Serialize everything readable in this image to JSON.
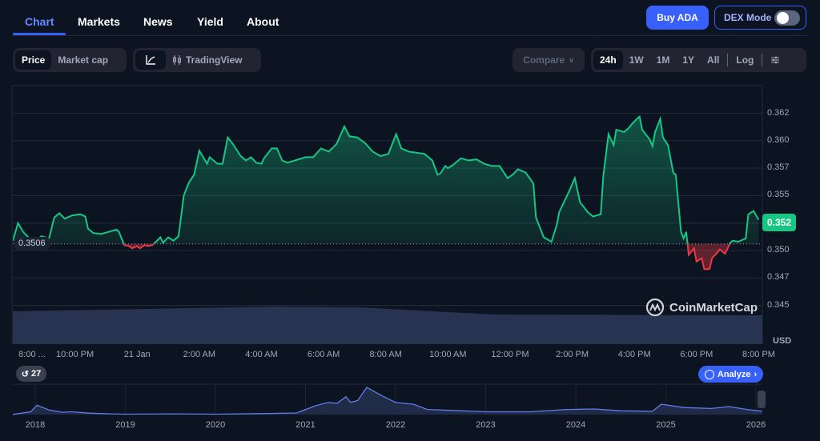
{
  "nav": {
    "tabs": [
      {
        "label": "Chart",
        "active": true
      },
      {
        "label": "Markets"
      },
      {
        "label": "News"
      },
      {
        "label": "Yield"
      },
      {
        "label": "About"
      }
    ],
    "buy_label": "Buy ADA",
    "dex_label": "DEX Mode",
    "dex_enabled": false
  },
  "toolbar": {
    "metric": [
      "Price",
      "Market cap"
    ],
    "metric_selected": "Price",
    "chart_type_line_icon": "line-chart-icon",
    "tradingview_label": "TradingView",
    "compare_label": "Compare",
    "ranges": [
      "24h",
      "1W",
      "1M",
      "1Y",
      "All"
    ],
    "range_selected": "24h",
    "log_label": "Log",
    "settings_icon": "sliders-icon"
  },
  "chart_data": {
    "type": "area",
    "currency": "USD",
    "current_price_label": "0.352",
    "baseline_label": "0.3506",
    "baseline": 0.3506,
    "ylim": [
      0.3415,
      0.365
    ],
    "y_ticks": [
      {
        "value": 0.3625,
        "label": "0.362"
      },
      {
        "value": 0.36,
        "label": "0.360"
      },
      {
        "value": 0.3575,
        "label": "0.357"
      },
      {
        "value": 0.355,
        "label": "0.355"
      },
      {
        "value": 0.3525,
        "label": "0.352"
      },
      {
        "value": 0.35,
        "label": "0.350"
      },
      {
        "value": 0.3475,
        "label": "0.347"
      },
      {
        "value": 0.345,
        "label": "0.345"
      }
    ],
    "x_ticks": [
      {
        "time": "20:00",
        "label": "8:00 ..."
      },
      {
        "time": "22:00",
        "label": "10:00 PM"
      },
      {
        "time": "00:00",
        "label": "21 Jan"
      },
      {
        "time": "02:00",
        "label": "2:00 AM"
      },
      {
        "time": "04:00",
        "label": "4:00 AM"
      },
      {
        "time": "06:00",
        "label": "6:00 AM"
      },
      {
        "time": "08:00",
        "label": "8:00 AM"
      },
      {
        "time": "10:00",
        "label": "10:00 AM"
      },
      {
        "time": "12:00",
        "label": "12:00 PM"
      },
      {
        "time": "14:00",
        "label": "2:00 PM"
      },
      {
        "time": "16:00",
        "label": "4:00 PM"
      },
      {
        "time": "18:00",
        "label": "6:00 PM"
      },
      {
        "time": "20:00",
        "label": "8:00 PM"
      }
    ],
    "points": [
      [
        "20:00",
        0.3509
      ],
      [
        "20:10",
        0.3525
      ],
      [
        "20:20",
        0.3517
      ],
      [
        "20:30",
        0.3512
      ],
      [
        "20:45",
        0.3509
      ],
      [
        "20:55",
        0.3513
      ],
      [
        "21:10",
        0.3511
      ],
      [
        "21:20",
        0.353
      ],
      [
        "21:30",
        0.3534
      ],
      [
        "21:40",
        0.3529
      ],
      [
        "21:55",
        0.3532
      ],
      [
        "22:10",
        0.3533
      ],
      [
        "22:20",
        0.3531
      ],
      [
        "22:25",
        0.352
      ],
      [
        "22:35",
        0.3516
      ],
      [
        "22:50",
        0.3515
      ],
      [
        "23:05",
        0.3517
      ],
      [
        "23:20",
        0.3519
      ],
      [
        "23:25",
        0.3517
      ],
      [
        "23:35",
        0.3505
      ],
      [
        "23:45",
        0.3504
      ],
      [
        "23:50",
        0.3502
      ],
      [
        "00:00",
        0.3504
      ],
      [
        "00:05",
        0.3502
      ],
      [
        "00:15",
        0.3505
      ],
      [
        "00:20",
        0.3504
      ],
      [
        "00:30",
        0.3505
      ],
      [
        "00:45",
        0.3512
      ],
      [
        "00:50",
        0.3507
      ],
      [
        "01:00",
        0.3512
      ],
      [
        "01:10",
        0.3509
      ],
      [
        "01:20",
        0.3513
      ],
      [
        "01:30",
        0.355
      ],
      [
        "01:40",
        0.3562
      ],
      [
        "01:50",
        0.3569
      ],
      [
        "02:00",
        0.3591
      ],
      [
        "02:15",
        0.3579
      ],
      [
        "02:20",
        0.3585
      ],
      [
        "02:35",
        0.3579
      ],
      [
        "02:45",
        0.3579
      ],
      [
        "02:55",
        0.3603
      ],
      [
        "03:05",
        0.3597
      ],
      [
        "03:20",
        0.3586
      ],
      [
        "03:30",
        0.3582
      ],
      [
        "03:40",
        0.3585
      ],
      [
        "03:50",
        0.358
      ],
      [
        "04:00",
        0.3579
      ],
      [
        "04:05",
        0.3584
      ],
      [
        "04:20",
        0.3593
      ],
      [
        "04:30",
        0.3593
      ],
      [
        "04:40",
        0.3582
      ],
      [
        "04:50",
        0.358
      ],
      [
        "05:05",
        0.3582
      ],
      [
        "05:25",
        0.3585
      ],
      [
        "05:40",
        0.3585
      ],
      [
        "05:55",
        0.3593
      ],
      [
        "06:10",
        0.359
      ],
      [
        "06:25",
        0.3597
      ],
      [
        "06:40",
        0.3613
      ],
      [
        "06:50",
        0.3604
      ],
      [
        "07:05",
        0.3603
      ],
      [
        "07:20",
        0.3598
      ],
      [
        "07:35",
        0.359
      ],
      [
        "07:50",
        0.3586
      ],
      [
        "08:05",
        0.3588
      ],
      [
        "08:20",
        0.3606
      ],
      [
        "08:30",
        0.3593
      ],
      [
        "08:45",
        0.359
      ],
      [
        "09:00",
        0.3589
      ],
      [
        "09:15",
        0.3588
      ],
      [
        "09:30",
        0.3582
      ],
      [
        "09:40",
        0.3569
      ],
      [
        "09:45",
        0.357
      ],
      [
        "09:55",
        0.3577
      ],
      [
        "10:00",
        0.3575
      ],
      [
        "10:10",
        0.3578
      ],
      [
        "10:25",
        0.3584
      ],
      [
        "10:40",
        0.3582
      ],
      [
        "10:55",
        0.3583
      ],
      [
        "11:10",
        0.3579
      ],
      [
        "11:25",
        0.3577
      ],
      [
        "11:40",
        0.3577
      ],
      [
        "11:55",
        0.3566
      ],
      [
        "12:05",
        0.3569
      ],
      [
        "12:15",
        0.3574
      ],
      [
        "12:30",
        0.3571
      ],
      [
        "12:45",
        0.3561
      ],
      [
        "12:50",
        0.353
      ],
      [
        "13:05",
        0.3512
      ],
      [
        "13:20",
        0.3508
      ],
      [
        "13:30",
        0.3523
      ],
      [
        "13:35",
        0.3535
      ],
      [
        "13:55",
        0.3555
      ],
      [
        "14:05",
        0.3566
      ],
      [
        "14:15",
        0.3544
      ],
      [
        "14:30",
        0.3535
      ],
      [
        "14:40",
        0.3531
      ],
      [
        "14:55",
        0.3533
      ],
      [
        "15:00",
        0.3568
      ],
      [
        "15:10",
        0.3606
      ],
      [
        "15:20",
        0.3596
      ],
      [
        "15:25",
        0.361
      ],
      [
        "15:40",
        0.3608
      ],
      [
        "15:50",
        0.3612
      ],
      [
        "15:55",
        0.3615
      ],
      [
        "16:05",
        0.362
      ],
      [
        "16:10",
        0.3622
      ],
      [
        "16:15",
        0.361
      ],
      [
        "16:30",
        0.3601
      ],
      [
        "16:35",
        0.3595
      ],
      [
        "16:40",
        0.3608
      ],
      [
        "16:50",
        0.362
      ],
      [
        "16:55",
        0.3603
      ],
      [
        "17:05",
        0.3596
      ],
      [
        "17:15",
        0.3571
      ],
      [
        "17:20",
        0.3569
      ],
      [
        "17:30",
        0.3517
      ],
      [
        "17:35",
        0.3511
      ],
      [
        "17:40",
        0.3517
      ],
      [
        "17:45",
        0.3496
      ],
      [
        "17:55",
        0.3502
      ],
      [
        "18:00",
        0.349
      ],
      [
        "18:10",
        0.3493
      ],
      [
        "18:15",
        0.3483
      ],
      [
        "18:25",
        0.3483
      ],
      [
        "18:30",
        0.3493
      ],
      [
        "18:40",
        0.3498
      ],
      [
        "18:45",
        0.3501
      ],
      [
        "18:55",
        0.3497
      ],
      [
        "19:05",
        0.3507
      ],
      [
        "19:10",
        0.3509
      ],
      [
        "19:20",
        0.3508
      ],
      [
        "19:25",
        0.3509
      ],
      [
        "19:35",
        0.3511
      ],
      [
        "19:40",
        0.3533
      ],
      [
        "19:50",
        0.3536
      ],
      [
        "20:00",
        0.3528
      ]
    ],
    "colors": {
      "up": "#16c784",
      "down": "#ea3943",
      "volume": "#2b3557"
    }
  },
  "watermark": "CoinMarketCap",
  "axis_unit": "USD",
  "navigator": {
    "history_count": "27",
    "analyze_label": "Analyze",
    "year_ticks": [
      "2018",
      "2019",
      "2020",
      "2021",
      "2022",
      "2023",
      "2024",
      "2025",
      "2026"
    ],
    "points": [
      [
        2017.75,
        0.02
      ],
      [
        2017.95,
        0.3
      ],
      [
        2018.02,
        1.0
      ],
      [
        2018.15,
        0.5
      ],
      [
        2018.3,
        0.25
      ],
      [
        2018.4,
        0.3
      ],
      [
        2018.6,
        0.15
      ],
      [
        2018.85,
        0.08
      ],
      [
        2019.0,
        0.04
      ],
      [
        2019.5,
        0.08
      ],
      [
        2020.0,
        0.04
      ],
      [
        2020.5,
        0.1
      ],
      [
        2020.9,
        0.17
      ],
      [
        2021.1,
        0.9
      ],
      [
        2021.25,
        1.3
      ],
      [
        2021.35,
        1.2
      ],
      [
        2021.45,
        1.9
      ],
      [
        2021.5,
        1.3
      ],
      [
        2021.58,
        1.5
      ],
      [
        2021.68,
        2.9
      ],
      [
        2021.85,
        2.0
      ],
      [
        2022.0,
        1.3
      ],
      [
        2022.2,
        1.1
      ],
      [
        2022.35,
        0.55
      ],
      [
        2022.6,
        0.45
      ],
      [
        2023.0,
        0.3
      ],
      [
        2023.5,
        0.3
      ],
      [
        2023.9,
        0.55
      ],
      [
        2024.2,
        0.6
      ],
      [
        2024.5,
        0.4
      ],
      [
        2024.85,
        0.35
      ],
      [
        2024.95,
        1.1
      ],
      [
        2025.2,
        0.75
      ],
      [
        2025.5,
        0.65
      ],
      [
        2025.7,
        0.85
      ],
      [
        2025.9,
        0.55
      ],
      [
        2026.07,
        0.36
      ]
    ]
  }
}
